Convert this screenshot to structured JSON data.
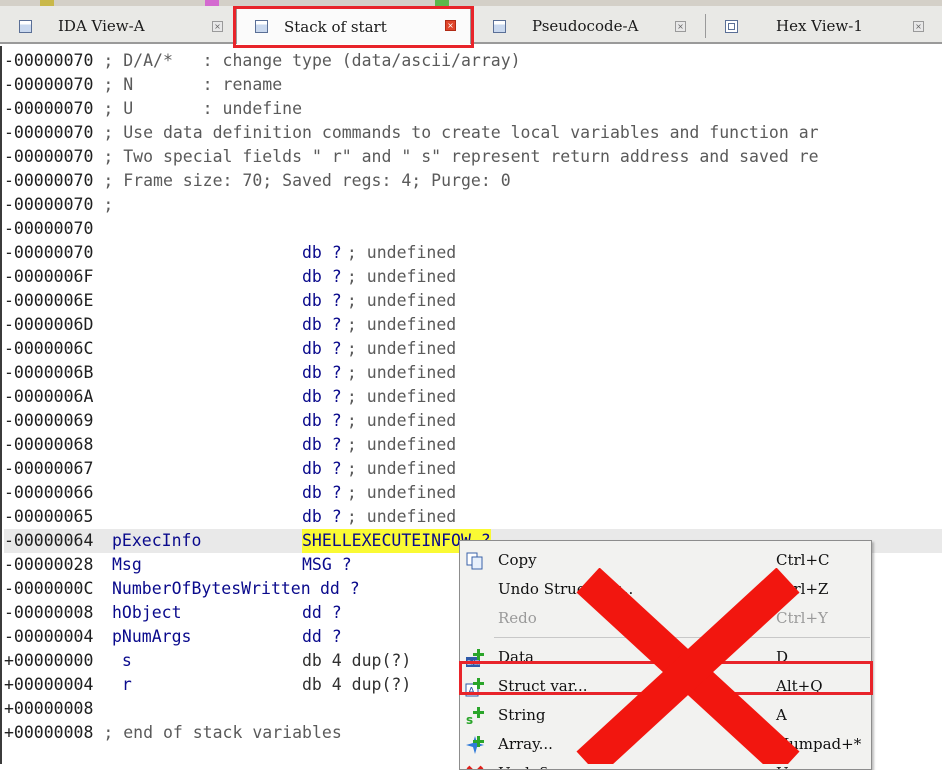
{
  "tabs": [
    {
      "label": "IDA View-A",
      "icon": "listing-icon",
      "active": false
    },
    {
      "label": "Stack of start",
      "icon": "listing-icon",
      "active": true
    },
    {
      "label": "Pseudocode-A",
      "icon": "listing-icon",
      "active": false
    },
    {
      "label": "Hex View-1",
      "icon": "hex-icon",
      "active": false
    }
  ],
  "tab_close_glyph": "×",
  "listing": {
    "lines": [
      {
        "addr": "-00000070",
        "text": " ; D/A/*   : change type (data/ascii/array)",
        "kind": "comment"
      },
      {
        "addr": "-00000070",
        "text": " ; N       : rename",
        "kind": "comment"
      },
      {
        "addr": "-00000070",
        "text": " ; U       : undefine",
        "kind": "comment"
      },
      {
        "addr": "-00000070",
        "text": " ; Use data definition commands to create local variables and function ar",
        "kind": "comment"
      },
      {
        "addr": "-00000070",
        "text": " ; Two special fields \" r\" and \" s\" represent return address and saved re",
        "kind": "comment"
      },
      {
        "addr": "-00000070",
        "text": " ; Frame size: 70; Saved regs: 4; Purge: 0",
        "kind": "comment"
      },
      {
        "addr": "-00000070",
        "text": " ;",
        "kind": "comment"
      },
      {
        "addr": "-00000070",
        "text": "",
        "kind": "comment"
      },
      {
        "addr": "-00000070",
        "name": "",
        "type": "db ?",
        "comment": " ; undefined",
        "kind": "field"
      },
      {
        "addr": "-0000006F",
        "name": "",
        "type": "db ?",
        "comment": " ; undefined",
        "kind": "field"
      },
      {
        "addr": "-0000006E",
        "name": "",
        "type": "db ?",
        "comment": " ; undefined",
        "kind": "field"
      },
      {
        "addr": "-0000006D",
        "name": "",
        "type": "db ?",
        "comment": " ; undefined",
        "kind": "field"
      },
      {
        "addr": "-0000006C",
        "name": "",
        "type": "db ?",
        "comment": " ; undefined",
        "kind": "field"
      },
      {
        "addr": "-0000006B",
        "name": "",
        "type": "db ?",
        "comment": " ; undefined",
        "kind": "field"
      },
      {
        "addr": "-0000006A",
        "name": "",
        "type": "db ?",
        "comment": " ; undefined",
        "kind": "field"
      },
      {
        "addr": "-00000069",
        "name": "",
        "type": "db ?",
        "comment": " ; undefined",
        "kind": "field"
      },
      {
        "addr": "-00000068",
        "name": "",
        "type": "db ?",
        "comment": " ; undefined",
        "kind": "field"
      },
      {
        "addr": "-00000067",
        "name": "",
        "type": "db ?",
        "comment": " ; undefined",
        "kind": "field"
      },
      {
        "addr": "-00000066",
        "name": "",
        "type": "db ?",
        "comment": " ; undefined",
        "kind": "field"
      },
      {
        "addr": "-00000065",
        "name": "",
        "type": "db ?",
        "comment": " ; undefined",
        "kind": "field"
      },
      {
        "addr": "-00000064",
        "name": "pExecInfo",
        "type": "SHELLEXECUTEINFOW ?",
        "comment": "",
        "kind": "field",
        "selected": true
      },
      {
        "addr": "-00000028",
        "name": "Msg",
        "type": "MSG ?",
        "comment": "",
        "kind": "field"
      },
      {
        "addr": "-0000000C",
        "name": "NumberOfBytesWritten",
        "type": "dd ?",
        "comment": "",
        "kind": "field"
      },
      {
        "addr": "-00000008",
        "name": "hObject",
        "type": "dd ?",
        "comment": "",
        "kind": "field"
      },
      {
        "addr": "-00000004",
        "name": "pNumArgs",
        "type": "dd ?",
        "comment": "",
        "kind": "field"
      },
      {
        "addr": "+00000000",
        "name": " s",
        "type": "db 4 dup(?)",
        "comment": "",
        "kind": "special"
      },
      {
        "addr": "+00000004",
        "name": " r",
        "type": "db 4 dup(?)",
        "comment": "",
        "kind": "special"
      },
      {
        "addr": "+00000008",
        "text": "",
        "kind": "comment"
      },
      {
        "addr": "+00000008",
        "text": " ; end of stack variables",
        "kind": "comment"
      }
    ]
  },
  "context_menu": {
    "items": [
      {
        "label": "Copy",
        "shortcut": "Ctrl+C",
        "icon": "copy-icon",
        "enabled": true
      },
      {
        "label": "Undo Struct var...",
        "shortcut": "Ctrl+Z",
        "icon": "",
        "enabled": true
      },
      {
        "label": "Redo",
        "shortcut": "Ctrl+Y",
        "icon": "",
        "enabled": false
      },
      {
        "separator": true
      },
      {
        "label": "Data",
        "shortcut": "D",
        "icon": "data-add-icon",
        "enabled": true
      },
      {
        "label": "Struct var...",
        "shortcut": "Alt+Q",
        "icon": "struct-add-icon",
        "enabled": true,
        "highlighted": true
      },
      {
        "label": "String",
        "shortcut": "A",
        "icon": "string-add-icon",
        "enabled": true
      },
      {
        "label": "Array...",
        "shortcut": "Numpad+*",
        "icon": "array-icon",
        "enabled": true
      },
      {
        "label": "Undefine",
        "shortcut": "U",
        "icon": "undefine-icon",
        "enabled": true
      }
    ]
  },
  "colors": {
    "annotation_red": "#e8242a",
    "highlight_yellow": "#fafa34",
    "name_blue": "#0a0a8c",
    "selection_row": "#e9e9e9"
  }
}
